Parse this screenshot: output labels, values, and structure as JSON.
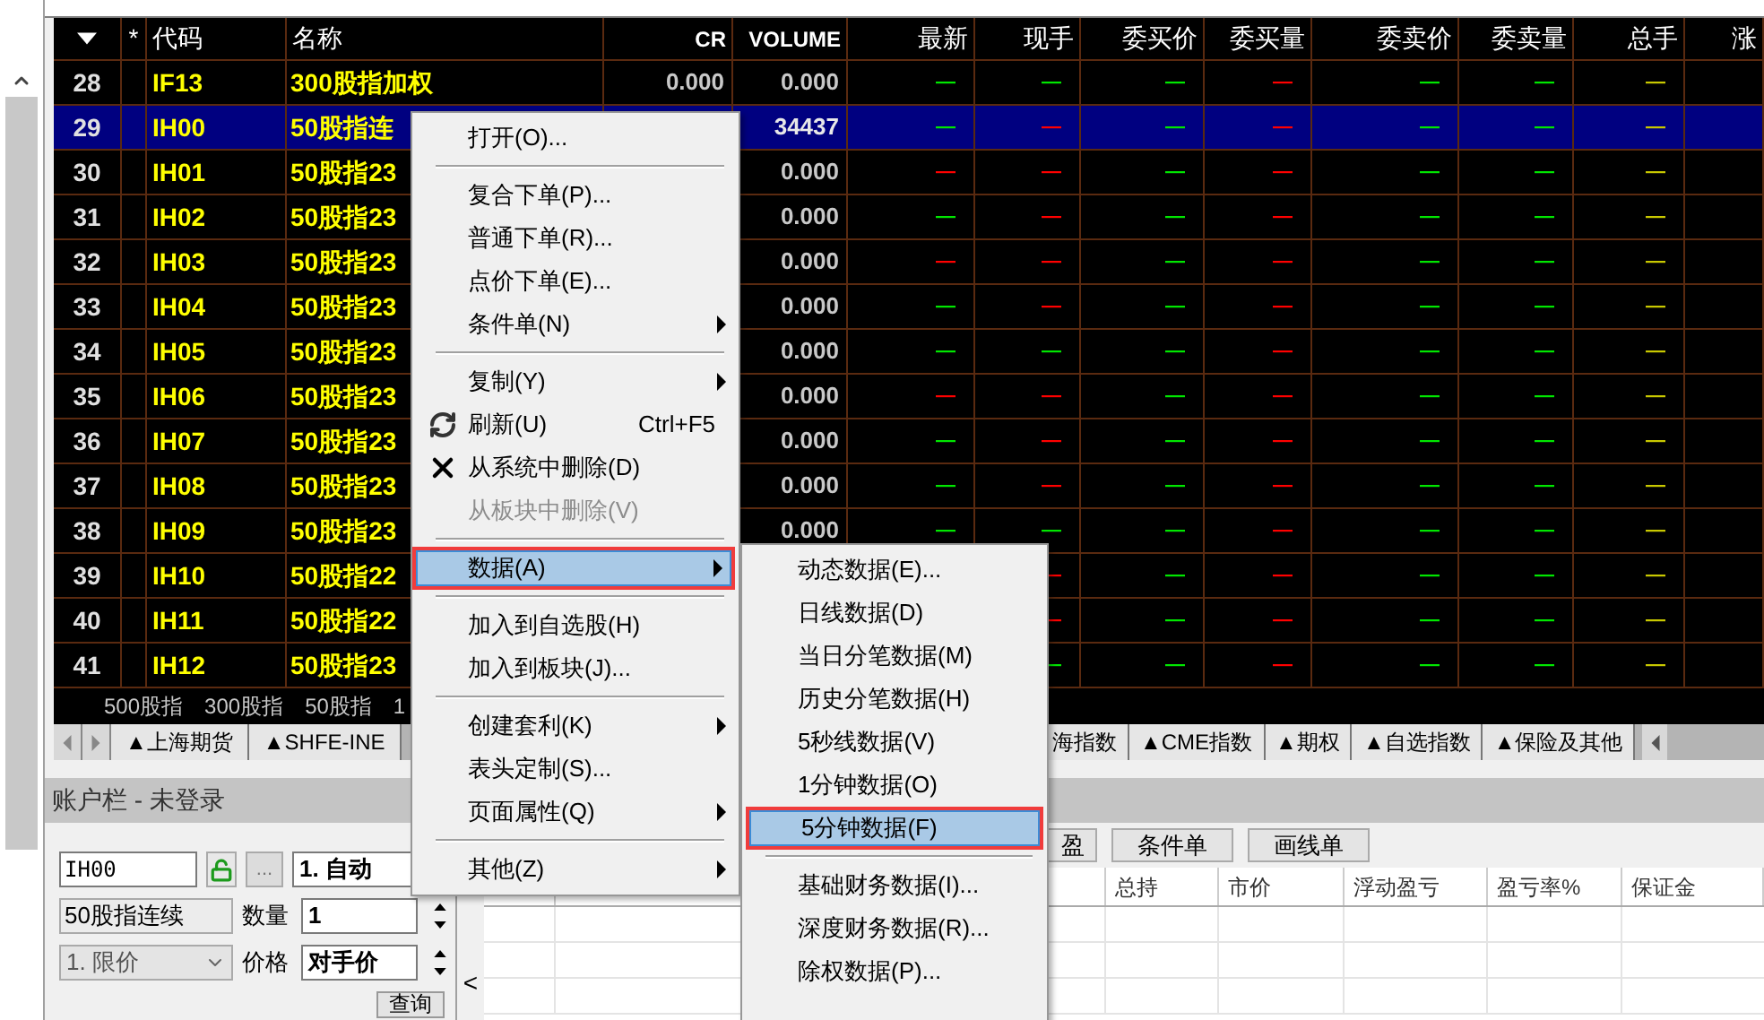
{
  "table": {
    "columns": [
      "*",
      "代码",
      "名称",
      "CR",
      "VOLUME",
      "最新",
      "现手",
      "委买价",
      "委买量",
      "委卖价",
      "委卖量",
      "总手",
      "涨"
    ],
    "rows": [
      {
        "no": "28",
        "code": "IF13",
        "name": "300股指加权",
        "cr": "0.000",
        "volume": "0.000",
        "selected": false,
        "quotes": [
          {
            "text": "—",
            "color": "#00e600"
          },
          {
            "text": "—",
            "color": "#00e600"
          },
          {
            "text": "—",
            "color": "#00e600"
          },
          {
            "text": "—",
            "color": "#ff0000"
          },
          {
            "text": "—",
            "color": "#00e600"
          },
          {
            "text": "—",
            "color": "#00e600"
          },
          {
            "text": "—",
            "color": "#c8c800"
          }
        ]
      },
      {
        "no": "29",
        "code": "IH00",
        "name": "50股指连",
        "volume": "34437",
        "selected": true,
        "quotes": [
          {
            "text": "—",
            "color": "#00e600"
          },
          {
            "text": "—",
            "color": "#ff0000"
          },
          {
            "text": "—",
            "color": "#00e600"
          },
          {
            "text": "—",
            "color": "#ff0000"
          },
          {
            "text": "—",
            "color": "#00e600"
          },
          {
            "text": "—",
            "color": "#00e600"
          },
          {
            "text": "—",
            "color": "#c8c800"
          }
        ]
      },
      {
        "no": "30",
        "code": "IH01",
        "name": "50股指23",
        "volume": "0.000",
        "selected": false,
        "quotes": [
          {
            "text": "—",
            "color": "#ff0000"
          },
          {
            "text": "—",
            "color": "#ff0000"
          },
          {
            "text": "—",
            "color": "#00e600"
          },
          {
            "text": "—",
            "color": "#ff0000"
          },
          {
            "text": "—",
            "color": "#00e600"
          },
          {
            "text": "—",
            "color": "#00e600"
          },
          {
            "text": "—",
            "color": "#c8c800"
          }
        ]
      },
      {
        "no": "31",
        "code": "IH02",
        "name": "50股指23",
        "volume": "0.000",
        "selected": false,
        "quotes": [
          {
            "text": "—",
            "color": "#00e600"
          },
          {
            "text": "—",
            "color": "#ff0000"
          },
          {
            "text": "—",
            "color": "#00e600"
          },
          {
            "text": "—",
            "color": "#ff0000"
          },
          {
            "text": "—",
            "color": "#00e600"
          },
          {
            "text": "—",
            "color": "#00e600"
          },
          {
            "text": "—",
            "color": "#c8c800"
          }
        ]
      },
      {
        "no": "32",
        "code": "IH03",
        "name": "50股指23",
        "volume": "0.000",
        "selected": false,
        "quotes": [
          {
            "text": "—",
            "color": "#ff0000"
          },
          {
            "text": "—",
            "color": "#ff0000"
          },
          {
            "text": "—",
            "color": "#00e600"
          },
          {
            "text": "—",
            "color": "#ff0000"
          },
          {
            "text": "—",
            "color": "#00e600"
          },
          {
            "text": "—",
            "color": "#00e600"
          },
          {
            "text": "—",
            "color": "#c8c800"
          }
        ]
      },
      {
        "no": "33",
        "code": "IH04",
        "name": "50股指23",
        "volume": "0.000",
        "selected": false,
        "quotes": [
          {
            "text": "—",
            "color": "#00e600"
          },
          {
            "text": "—",
            "color": "#ff0000"
          },
          {
            "text": "—",
            "color": "#00e600"
          },
          {
            "text": "—",
            "color": "#ff0000"
          },
          {
            "text": "—",
            "color": "#00e600"
          },
          {
            "text": "—",
            "color": "#00e600"
          },
          {
            "text": "—",
            "color": "#c8c800"
          }
        ]
      },
      {
        "no": "34",
        "code": "IH05",
        "name": "50股指23",
        "volume": "0.000",
        "selected": false,
        "quotes": [
          {
            "text": "—",
            "color": "#00e600"
          },
          {
            "text": "—",
            "color": "#00e600"
          },
          {
            "text": "—",
            "color": "#00e600"
          },
          {
            "text": "—",
            "color": "#ff0000"
          },
          {
            "text": "—",
            "color": "#00e600"
          },
          {
            "text": "—",
            "color": "#00e600"
          },
          {
            "text": "—",
            "color": "#c8c800"
          }
        ]
      },
      {
        "no": "35",
        "code": "IH06",
        "name": "50股指23",
        "volume": "0.000",
        "selected": false,
        "quotes": [
          {
            "text": "—",
            "color": "#ff0000"
          },
          {
            "text": "—",
            "color": "#ff0000"
          },
          {
            "text": "—",
            "color": "#00e600"
          },
          {
            "text": "—",
            "color": "#ff0000"
          },
          {
            "text": "—",
            "color": "#00e600"
          },
          {
            "text": "—",
            "color": "#00e600"
          },
          {
            "text": "—",
            "color": "#c8c800"
          }
        ]
      },
      {
        "no": "36",
        "code": "IH07",
        "name": "50股指23",
        "volume": "0.000",
        "selected": false,
        "quotes": [
          {
            "text": "—",
            "color": "#00e600"
          },
          {
            "text": "—",
            "color": "#ff0000"
          },
          {
            "text": "—",
            "color": "#00e600"
          },
          {
            "text": "—",
            "color": "#ff0000"
          },
          {
            "text": "—",
            "color": "#00e600"
          },
          {
            "text": "—",
            "color": "#00e600"
          },
          {
            "text": "—",
            "color": "#c8c800"
          }
        ]
      },
      {
        "no": "37",
        "code": "IH08",
        "name": "50股指23",
        "volume": "0.000",
        "selected": false,
        "quotes": [
          {
            "text": "—",
            "color": "#00e600"
          },
          {
            "text": "—",
            "color": "#ff0000"
          },
          {
            "text": "—",
            "color": "#00e600"
          },
          {
            "text": "—",
            "color": "#ff0000"
          },
          {
            "text": "—",
            "color": "#00e600"
          },
          {
            "text": "—",
            "color": "#00e600"
          },
          {
            "text": "—",
            "color": "#c8c800"
          }
        ]
      },
      {
        "no": "38",
        "code": "IH09",
        "name": "50股指23",
        "volume": "0.000",
        "selected": false,
        "quotes": [
          {
            "text": "—",
            "color": "#00e600"
          },
          {
            "text": "—",
            "color": "#00e600"
          },
          {
            "text": "—",
            "color": "#00e600"
          },
          {
            "text": "—",
            "color": "#ff0000"
          },
          {
            "text": "—",
            "color": "#00e600"
          },
          {
            "text": "—",
            "color": "#00e600"
          },
          {
            "text": "—",
            "color": "#c8c800"
          }
        ]
      },
      {
        "no": "39",
        "code": "IH10",
        "name": "50股指22",
        "selected": false,
        "quotes": [
          {
            "text": "—",
            "color": "#ff0000"
          },
          {
            "text": "—",
            "color": "#00e600"
          },
          {
            "text": "—",
            "color": "#ff0000"
          },
          {
            "text": "—",
            "color": "#00e600"
          },
          {
            "text": "—",
            "color": "#00e600"
          },
          {
            "text": "—",
            "color": "#c8c800"
          }
        ]
      },
      {
        "no": "40",
        "code": "IH11",
        "name": "50股指22",
        "selected": false,
        "quotes": [
          {
            "text": "—",
            "color": "#ff0000"
          },
          {
            "text": "—",
            "color": "#00e600"
          },
          {
            "text": "—",
            "color": "#ff0000"
          },
          {
            "text": "—",
            "color": "#00e600"
          },
          {
            "text": "—",
            "color": "#00e600"
          },
          {
            "text": "—",
            "color": "#c8c800"
          }
        ]
      },
      {
        "no": "41",
        "code": "IH12",
        "name": "50股指23",
        "selected": false,
        "quotes": [
          {
            "text": "—",
            "color": "#00e600"
          },
          {
            "text": "—",
            "color": "#00e600"
          },
          {
            "text": "—",
            "color": "#ff0000"
          },
          {
            "text": "—",
            "color": "#00e600"
          },
          {
            "text": "—",
            "color": "#00e600"
          },
          {
            "text": "—",
            "color": "#c8c800"
          }
        ]
      }
    ]
  },
  "board_tabs": [
    "500股指",
    "300股指",
    "50股指",
    "1"
  ],
  "sheet_tabs": {
    "left": [
      "▲上海期货",
      "▲SHFE-INE"
    ],
    "right": [
      "海指数",
      "▲CME指数",
      "▲期权",
      "▲自选指数",
      "▲保险及其他"
    ]
  },
  "account_bar": {
    "title": "账户栏 - 未登录"
  },
  "order_form": {
    "code": "IH00",
    "more": "...",
    "mode": "1. 自动",
    "name": "50股指连续",
    "quantity_label": "数量",
    "quantity": "1",
    "price_type": "1. 限价",
    "price_label": "价格",
    "price": "对手价",
    "query": "查询",
    "collapse": "<"
  },
  "order_buttons": [
    "盈",
    "条件单",
    "画线单"
  ],
  "positions": {
    "columns": [
      "总持",
      "市价",
      "浮动盈亏",
      "盈亏率%",
      "保证金"
    ]
  },
  "context_menu": {
    "items": [
      {
        "kind": "item",
        "label": "打开(O)...",
        "submenu": false,
        "selected": false,
        "disabled": false,
        "annotated": false
      },
      {
        "kind": "separator"
      },
      {
        "kind": "item",
        "label": "复合下单(P)...",
        "submenu": false,
        "selected": false,
        "disabled": false,
        "annotated": false
      },
      {
        "kind": "item",
        "label": "普通下单(R)...",
        "submenu": false,
        "selected": false,
        "disabled": false,
        "annotated": false
      },
      {
        "kind": "item",
        "label": "点价下单(E)...",
        "submenu": false,
        "selected": false,
        "disabled": false,
        "annotated": false
      },
      {
        "kind": "item",
        "label": "条件单(N)",
        "submenu": true,
        "selected": false,
        "disabled": false,
        "annotated": false
      },
      {
        "kind": "separator"
      },
      {
        "kind": "item",
        "label": "复制(Y)",
        "submenu": true,
        "selected": false,
        "disabled": false,
        "annotated": false
      },
      {
        "kind": "item",
        "label": "刷新(U)",
        "shortcut": "Ctrl+F5",
        "submenu": false,
        "selected": false,
        "disabled": false,
        "annotated": false
      },
      {
        "kind": "item",
        "label": "从系统中删除(D)",
        "submenu": false,
        "selected": false,
        "disabled": false,
        "annotated": false
      },
      {
        "kind": "item",
        "label": "从板块中删除(V)",
        "submenu": false,
        "selected": false,
        "disabled": true,
        "annotated": false
      },
      {
        "kind": "separator"
      },
      {
        "kind": "item",
        "label": "数据(A)",
        "submenu": true,
        "selected": true,
        "disabled": false,
        "annotated": true
      },
      {
        "kind": "separator"
      },
      {
        "kind": "item",
        "label": "加入到自选股(H)",
        "submenu": false,
        "selected": false,
        "disabled": false,
        "annotated": false
      },
      {
        "kind": "item",
        "label": "加入到板块(J)...",
        "submenu": false,
        "selected": false,
        "disabled": false,
        "annotated": false
      },
      {
        "kind": "separator"
      },
      {
        "kind": "item",
        "label": "创建套利(K)",
        "submenu": true,
        "selected": false,
        "disabled": false,
        "annotated": false
      },
      {
        "kind": "item",
        "label": "表头定制(S)...",
        "submenu": false,
        "selected": false,
        "disabled": false,
        "annotated": false
      },
      {
        "kind": "item",
        "label": "页面属性(Q)",
        "submenu": true,
        "selected": false,
        "disabled": false,
        "annotated": false
      },
      {
        "kind": "separator"
      },
      {
        "kind": "item",
        "label": "其他(Z)",
        "submenu": true,
        "selected": false,
        "disabled": false,
        "annotated": false
      }
    ]
  },
  "data_submenu": {
    "items": [
      {
        "kind": "item",
        "label": "动态数据(E)...",
        "submenu": false,
        "selected": false,
        "disabled": false,
        "annotated": false
      },
      {
        "kind": "item",
        "label": "日线数据(D)",
        "submenu": false,
        "selected": false,
        "disabled": false,
        "annotated": false
      },
      {
        "kind": "item",
        "label": "当日分笔数据(M)",
        "submenu": false,
        "selected": false,
        "disabled": false,
        "annotated": false
      },
      {
        "kind": "item",
        "label": "历史分笔数据(H)",
        "submenu": false,
        "selected": false,
        "disabled": false,
        "annotated": false
      },
      {
        "kind": "item",
        "label": "5秒线数据(V)",
        "submenu": false,
        "selected": false,
        "disabled": false,
        "annotated": false
      },
      {
        "kind": "item",
        "label": "1分钟数据(O)",
        "submenu": false,
        "selected": false,
        "disabled": false,
        "annotated": false
      },
      {
        "kind": "item",
        "label": "5分钟数据(F)",
        "submenu": false,
        "selected": true,
        "disabled": false,
        "annotated": true
      },
      {
        "kind": "separator"
      },
      {
        "kind": "item",
        "label": "基础财务数据(I)...",
        "submenu": false,
        "selected": false,
        "disabled": false,
        "annotated": false
      },
      {
        "kind": "item",
        "label": "深度财务数据(R)...",
        "submenu": false,
        "selected": false,
        "disabled": false,
        "annotated": false
      },
      {
        "kind": "item",
        "label": "除权数据(P)...",
        "submenu": false,
        "selected": false,
        "disabled": false,
        "annotated": false
      }
    ]
  }
}
